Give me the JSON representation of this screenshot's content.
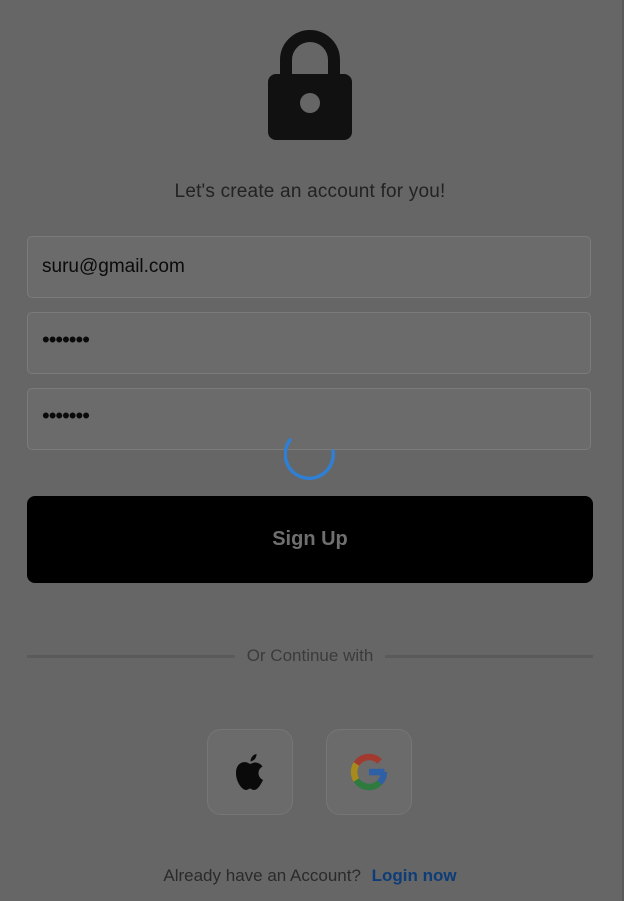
{
  "screen": {
    "subtitle": "Let's create an account for you!"
  },
  "form": {
    "email_value": "suru@gmail.com",
    "password_value": "•••••••",
    "confirm_password_value": "•••••••",
    "signup_label": "Sign Up"
  },
  "divider": {
    "label": "Or Continue with"
  },
  "social": {
    "apple_icon": "apple-icon",
    "google_icon": "google-icon"
  },
  "footer": {
    "prompt": "Already have an Account?",
    "login_label": "Login now"
  },
  "colors": {
    "overlay": "#666666",
    "spinner": "#2f7fd4",
    "link": "#0d3d78"
  }
}
